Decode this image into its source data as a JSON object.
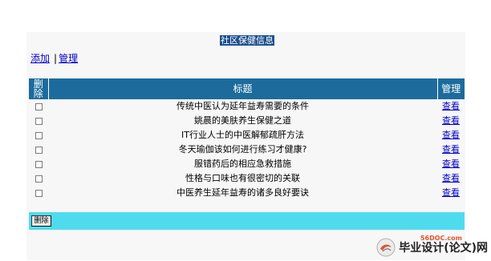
{
  "page": {
    "title": "社区保健信息"
  },
  "toolbar": {
    "add_label": "添加",
    "separator": "|",
    "manage_label": "管理"
  },
  "table": {
    "headers": {
      "delete": "删除",
      "title": "标题",
      "manage": "管理"
    },
    "rows": [
      {
        "title": "传统中医认为延年益寿需要的条件",
        "action": "查看"
      },
      {
        "title": "姚晨的美肤养生保健之道",
        "action": "查看"
      },
      {
        "title": "IT行业人士的中医解郁疏肝方法",
        "action": "查看"
      },
      {
        "title": "冬天瑜伽该如何进行练习才健康?",
        "action": "查看"
      },
      {
        "title": "服错药后的相应急救措施",
        "action": "查看"
      },
      {
        "title": "性格与口味也有很密切的关联",
        "action": "查看"
      },
      {
        "title": "中医养生延年益寿的诸多良好要诀",
        "action": "查看"
      }
    ]
  },
  "actions": {
    "delete_label": "删除"
  },
  "watermark": {
    "site": "56DOC.com",
    "text": "毕业设计(论文)网"
  },
  "colors": {
    "header_bg": "#1d6b9c",
    "title_bg": "#1c4f8e",
    "action_bar_bg": "#4fdbee",
    "link": "#0000cc"
  }
}
